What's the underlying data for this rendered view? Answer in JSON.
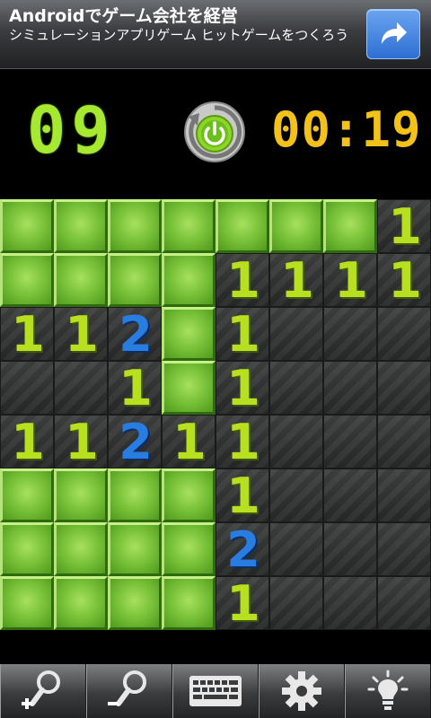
{
  "ad": {
    "title": "Androidでゲーム会社を経営",
    "body": "シミュレーションアプリゲーム ヒットゲームをつくろう",
    "action_icon": "share-arrow-icon",
    "accent": "#3a7fe0"
  },
  "header": {
    "mines_remaining": "09",
    "reset_icon": "power-reset-icon",
    "timer": "00:19"
  },
  "board": {
    "rows": [
      [
        "",
        "",
        "",
        "",
        "",
        "",
        "",
        "1"
      ],
      [
        "",
        "",
        "",
        "",
        "1",
        "1",
        "1",
        "1"
      ],
      [
        "1",
        "1",
        "2",
        "",
        "1",
        " ",
        " ",
        " "
      ],
      [
        " ",
        " ",
        "1",
        "",
        "1",
        " ",
        " ",
        " "
      ],
      [
        "1",
        "1",
        "2",
        "1",
        "1",
        " ",
        " ",
        " "
      ],
      [
        "",
        "",
        "",
        "",
        "1",
        " ",
        " ",
        " "
      ],
      [
        "",
        "",
        "",
        "",
        "2",
        " ",
        " ",
        " "
      ],
      [
        "",
        "",
        "",
        "",
        "1",
        " ",
        " ",
        " "
      ]
    ],
    "legend": "empty string = covered tile; space = revealed blank; digit = revealed number"
  },
  "toolbar": {
    "buttons": [
      {
        "name": "zoom-in",
        "icon": "zoom-in-icon"
      },
      {
        "name": "zoom-out",
        "icon": "zoom-out-icon"
      },
      {
        "name": "keyboard",
        "icon": "keyboard-icon"
      },
      {
        "name": "settings",
        "icon": "gear-icon"
      },
      {
        "name": "hint",
        "icon": "lightbulb-icon"
      }
    ]
  },
  "colors": {
    "mines_counter": "#a7e830",
    "timer": "#f2c21a",
    "number_1": "#b9e020",
    "number_2": "#2a7de0",
    "covered_tile": "#7cc43a",
    "revealed_tile": "#303131"
  }
}
